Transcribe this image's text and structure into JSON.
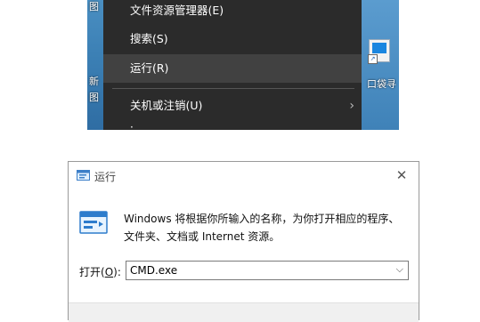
{
  "desktop": {
    "left_texts": [
      "图",
      "新",
      "图"
    ],
    "right_label": "口袋寻"
  },
  "context_menu": {
    "items": [
      {
        "label": "文件资源管理器(E)"
      },
      {
        "label": "搜索(S)"
      },
      {
        "label": "运行(R)"
      },
      {
        "label": "关机或注销(U)"
      }
    ],
    "submenu_arrow": "›",
    "partial_glyph": "·"
  },
  "run_dialog": {
    "title": "运行",
    "close_glyph": "✕",
    "description_line1": "Windows 将根据你所输入的名称，为你打开相应的程序、",
    "description_line2": "文件夹、文档或 Internet 资源。",
    "open_label": "打开(",
    "open_label_key": "O",
    "open_label_end": "):",
    "input_value": "CMD.exe",
    "dropdown_glyph": "⌵",
    "icons": [
      "run-app-icon",
      "dropdown-chevron-icon",
      "close-icon"
    ]
  }
}
